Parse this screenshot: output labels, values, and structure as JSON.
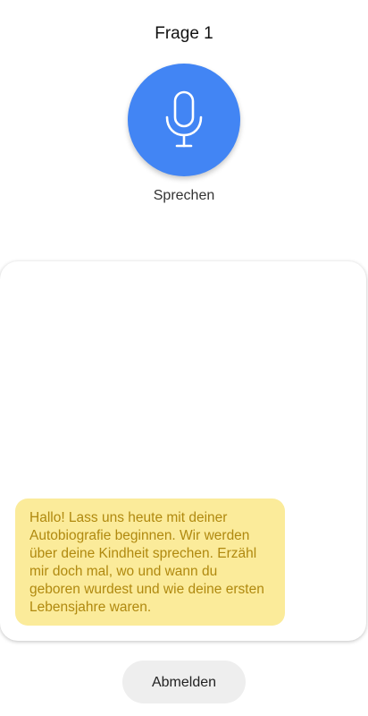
{
  "header": {
    "question_title": "Frage 1"
  },
  "mic": {
    "icon": "microphone-icon",
    "label": "Sprechen",
    "color": "#4285f4"
  },
  "chat": {
    "messages": [
      {
        "text": "Hallo! Lass uns heute mit deiner Autobiografie beginnen. Wir werden über deine Kindheit sprechen. Erzähl mir doch mal, wo und wann du geboren wurdest und wie deine ersten Lebensjahre waren.",
        "bubble_color": "#fbeb9a",
        "text_color": "#b0890f"
      }
    ]
  },
  "footer": {
    "logout_label": "Abmelden"
  }
}
